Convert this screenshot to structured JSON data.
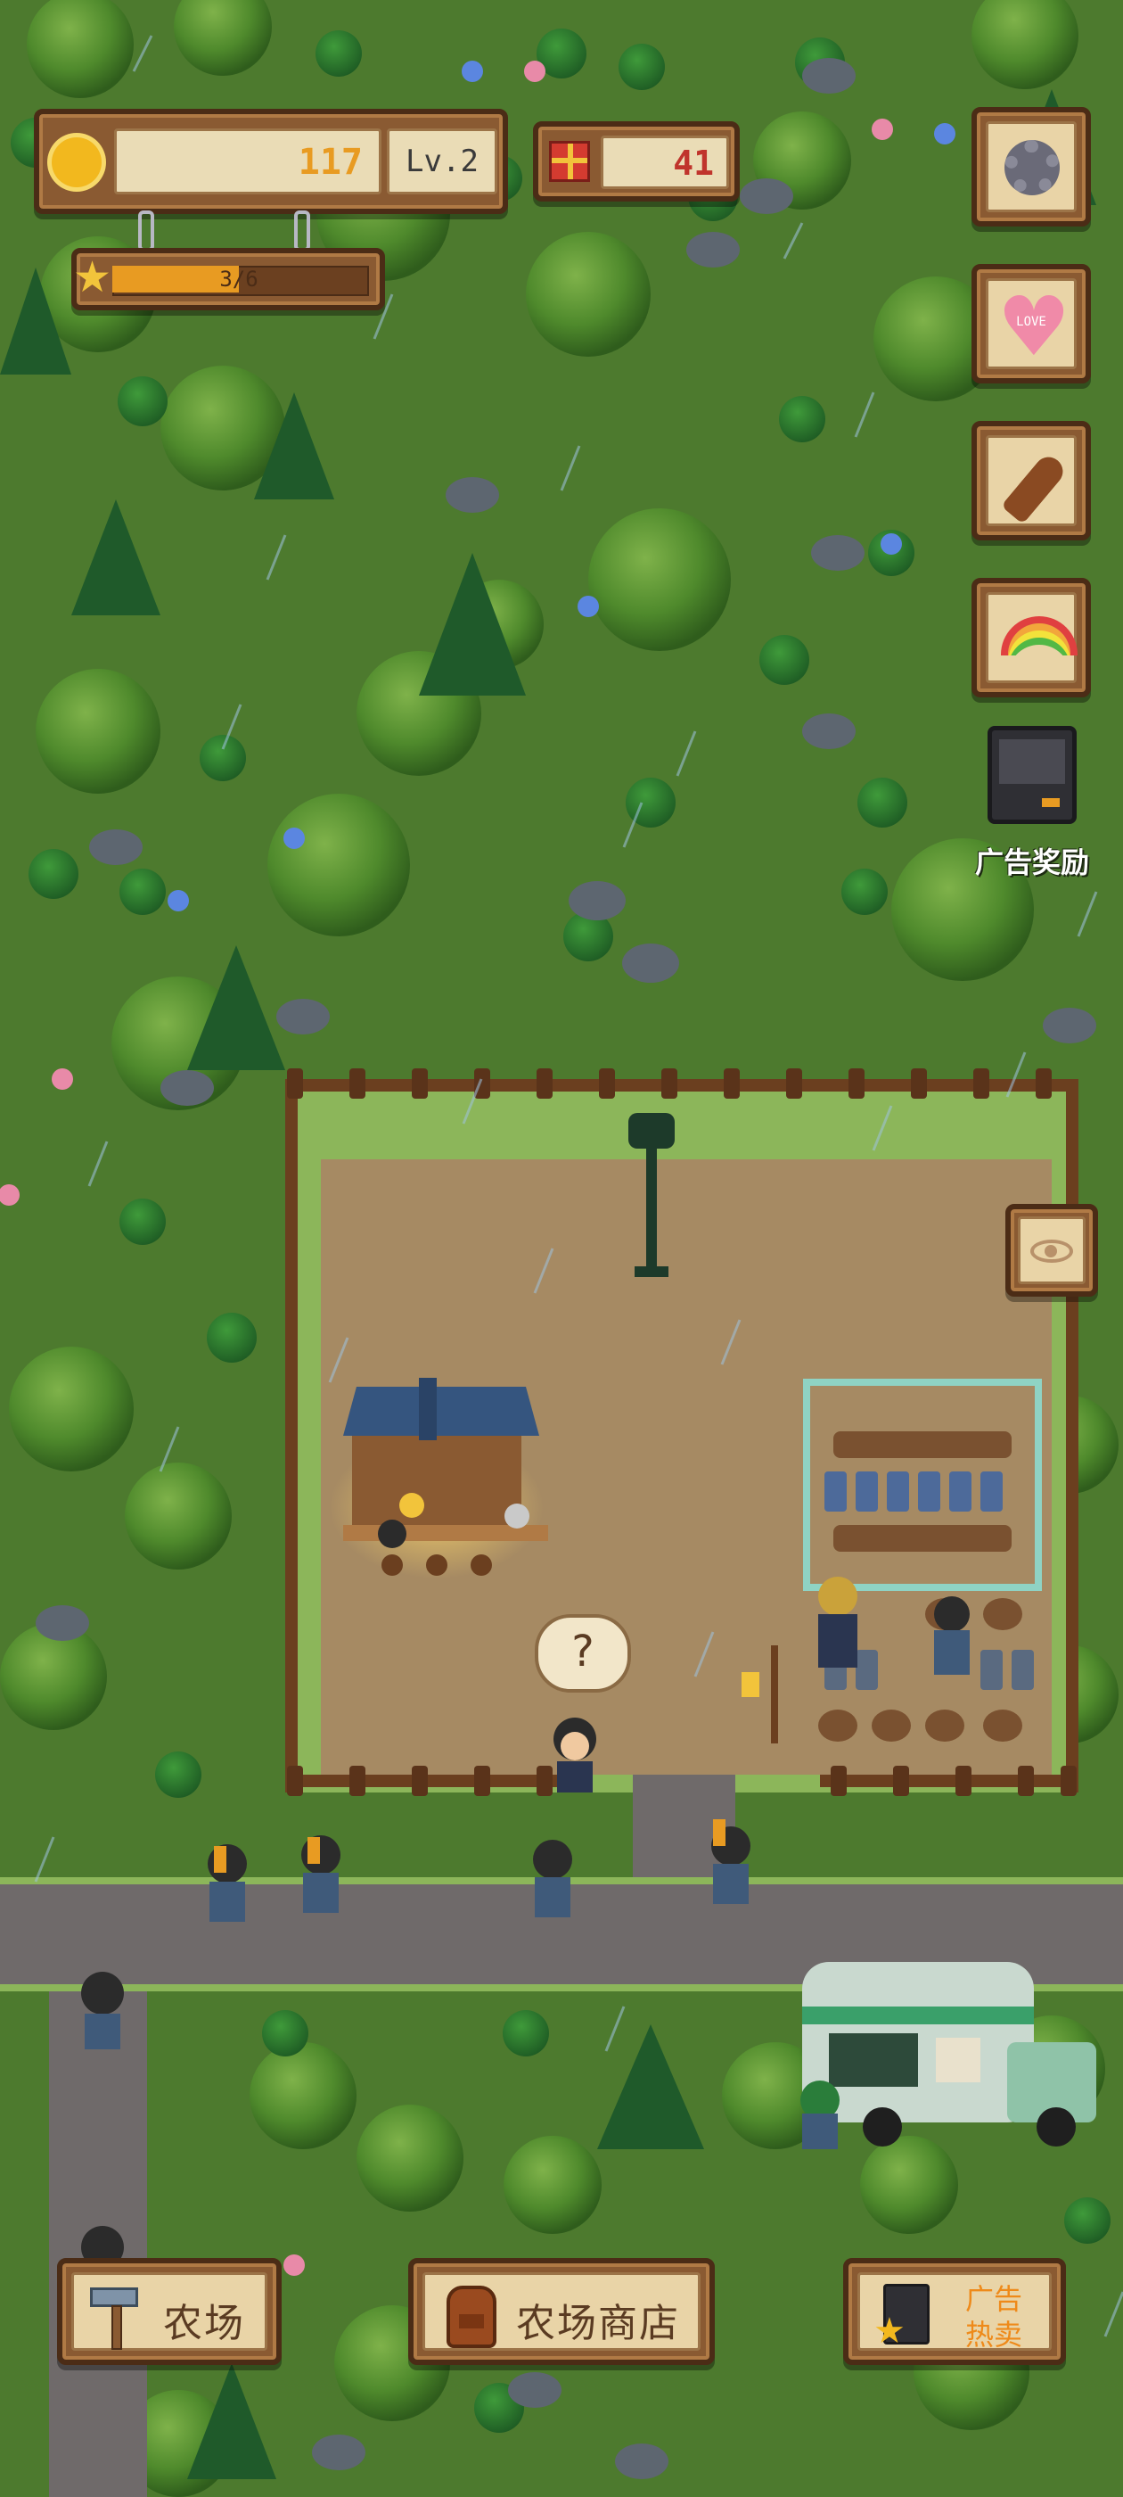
{
  "hud": {
    "coins": "117",
    "level": "Lv.2",
    "gifts": "41",
    "xp_text": "3/6",
    "xp_progress": 0.5,
    "coin_icon": "sun-coin-icon",
    "gift_icon": "gift-box-icon",
    "star_icon": "star-icon"
  },
  "side_buttons": [
    {
      "name": "settings",
      "icon": "gear-icon"
    },
    {
      "name": "love",
      "icon": "love-heart-icon",
      "icon_text": "LOVE"
    },
    {
      "name": "carrot",
      "icon": "carrot-icon"
    },
    {
      "name": "rainbow",
      "icon": "rainbow-icon"
    }
  ],
  "ad_reward": {
    "label": "广告奖励",
    "icon": "tv-icon"
  },
  "view_toggle": {
    "icon": "eye-icon"
  },
  "npc_bubble": {
    "symbol": "?"
  },
  "bottom_bar": {
    "farm": {
      "label": "农场",
      "icon": "hammer-icon"
    },
    "shop": {
      "label": "农场商店",
      "icon": "backpack-icon"
    },
    "ad_hot": {
      "line1": "广告",
      "line2": "热卖",
      "icon": "tv-star-icon"
    }
  },
  "colors": {
    "grass": "#4d7a2e",
    "dirt": "#a68a63",
    "road": "#6f6a6a",
    "wood": "#8a5a32",
    "coin": "#e89b22",
    "gift": "#c0342c"
  }
}
